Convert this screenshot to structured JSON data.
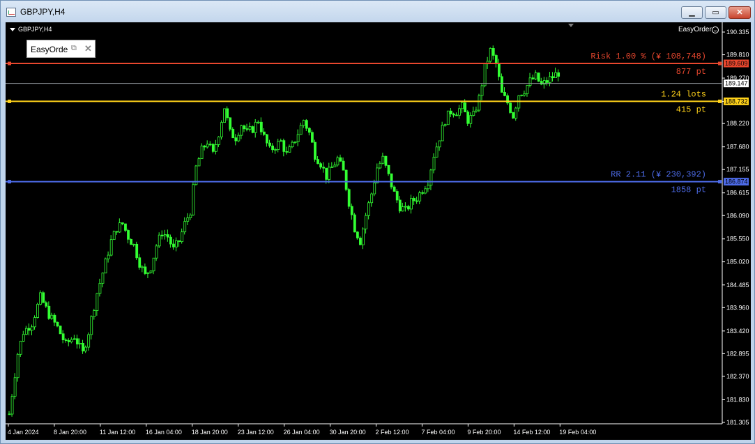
{
  "window": {
    "title": "GBPJPY,H4"
  },
  "window_buttons": {
    "minimize": "▁",
    "maximize": "▭",
    "close": "✕"
  },
  "chart_header": {
    "symbol": "GBPJPY,H4",
    "ea_name": "EasyOrder",
    "ea_status_icon": "smile-icon"
  },
  "ea_panel": {
    "title": "EasyOrde",
    "restore_icon": "⧉",
    "close_icon": "✕"
  },
  "trade_lines": {
    "stop_loss": {
      "price": "189.609",
      "color": "#e8472e",
      "label": "Risk 1.00 % (¥ 108,748)",
      "points": "877 pt"
    },
    "entry": {
      "price": "188.732",
      "color": "#ffd21a",
      "label": "1.24 lots",
      "points": "415 pt"
    },
    "take_profit": {
      "price": "186.874",
      "color": "#4d6be8",
      "label": "RR 2.11 (¥ 230,392)",
      "points": "1858 pt"
    },
    "bid": {
      "price": "189.147",
      "color": "#9aa0a6"
    }
  },
  "chart_data": {
    "type": "candlestick",
    "candle_color": "#33ff33",
    "y_ticks": [
      "190.335",
      "189.810",
      "189.270",
      "188.732",
      "188.220",
      "187.680",
      "187.155",
      "186.615",
      "186.090",
      "185.550",
      "185.020",
      "184.485",
      "183.960",
      "183.420",
      "182.895",
      "182.370",
      "181.830",
      "181.305"
    ],
    "ylim": [
      181.305,
      190.335
    ],
    "x_ticks": [
      "4 Jan 2024",
      "8 Jan 20:00",
      "11 Jan 12:00",
      "16 Jan 04:00",
      "18 Jan 20:00",
      "23 Jan 12:00",
      "26 Jan 04:00",
      "30 Jan 20:00",
      "2 Feb 12:00",
      "7 Feb 04:00",
      "9 Feb 20:00",
      "14 Feb 12:00",
      "19 Feb 04:00"
    ],
    "close_path": [
      [
        0,
        181.5
      ],
      [
        3,
        182.9
      ],
      [
        5,
        183.4
      ],
      [
        8,
        183.6
      ],
      [
        11,
        184.2
      ],
      [
        14,
        183.8
      ],
      [
        17,
        183.5
      ],
      [
        20,
        183.1
      ],
      [
        23,
        183.3
      ],
      [
        26,
        182.9
      ],
      [
        28,
        183.4
      ],
      [
        31,
        184.3
      ],
      [
        34,
        185.0
      ],
      [
        36,
        185.5
      ],
      [
        38,
        185.8
      ],
      [
        40,
        185.9
      ],
      [
        42,
        185.6
      ],
      [
        44,
        185.4
      ],
      [
        46,
        185.0
      ],
      [
        48,
        184.7
      ],
      [
        50,
        184.9
      ],
      [
        52,
        185.4
      ],
      [
        54,
        185.7
      ],
      [
        56,
        185.6
      ],
      [
        58,
        185.3
      ],
      [
        60,
        185.5
      ],
      [
        62,
        185.9
      ],
      [
        64,
        186.2
      ],
      [
        66,
        187.2
      ],
      [
        68,
        187.6
      ],
      [
        70,
        187.8
      ],
      [
        72,
        187.5
      ],
      [
        74,
        188.0
      ],
      [
        76,
        188.6
      ],
      [
        78,
        188.0
      ],
      [
        80,
        187.9
      ],
      [
        82,
        188.2
      ],
      [
        84,
        188.0
      ],
      [
        86,
        188.1
      ],
      [
        88,
        188.3
      ],
      [
        90,
        187.9
      ],
      [
        92,
        187.6
      ],
      [
        94,
        187.7
      ],
      [
        96,
        187.8
      ],
      [
        98,
        187.5
      ],
      [
        100,
        187.7
      ],
      [
        102,
        188.0
      ],
      [
        104,
        188.3
      ],
      [
        106,
        188.0
      ],
      [
        108,
        187.5
      ],
      [
        110,
        187.3
      ],
      [
        112,
        187.0
      ],
      [
        114,
        187.2
      ],
      [
        116,
        187.4
      ],
      [
        118,
        187.1
      ],
      [
        120,
        186.4
      ],
      [
        122,
        185.8
      ],
      [
        124,
        185.5
      ],
      [
        126,
        186.1
      ],
      [
        128,
        186.6
      ],
      [
        130,
        187.2
      ],
      [
        132,
        187.4
      ],
      [
        134,
        187.0
      ],
      [
        136,
        186.6
      ],
      [
        138,
        186.3
      ],
      [
        140,
        186.2
      ],
      [
        142,
        186.4
      ],
      [
        144,
        186.5
      ],
      [
        146,
        186.7
      ],
      [
        148,
        186.9
      ],
      [
        150,
        187.5
      ],
      [
        152,
        187.9
      ],
      [
        154,
        188.3
      ],
      [
        156,
        188.5
      ],
      [
        158,
        188.5
      ],
      [
        160,
        188.6
      ],
      [
        162,
        188.3
      ],
      [
        164,
        188.4
      ],
      [
        166,
        188.8
      ],
      [
        168,
        189.5
      ],
      [
        170,
        189.9
      ],
      [
        172,
        189.6
      ],
      [
        174,
        188.9
      ],
      [
        176,
        188.7
      ],
      [
        178,
        188.4
      ],
      [
        180,
        188.9
      ],
      [
        182,
        189.0
      ],
      [
        184,
        189.2
      ],
      [
        186,
        189.3
      ],
      [
        188,
        189.1
      ],
      [
        190,
        189.2
      ],
      [
        192,
        189.3
      ],
      [
        194,
        189.4
      ]
    ]
  }
}
